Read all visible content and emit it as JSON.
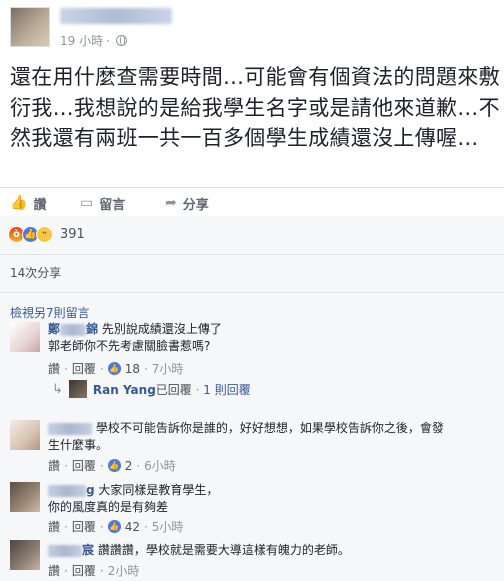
{
  "post": {
    "time": "19 小時",
    "text": "還在用什麼查需要時間…可能會有個資法的問題來敷衍我…我想說的是給我學生名字或是請他來道歉…不然我還有兩班一共一百多個學生成績還沒上傳喔…"
  },
  "actions": {
    "like": "讚",
    "comment": "留言",
    "share": "分享"
  },
  "reactions": {
    "count": "391",
    "icons": [
      "angry-icon",
      "like-icon",
      "haha-icon"
    ]
  },
  "shares": "14次分享",
  "view_more": "檢視另7則留言",
  "comments": [
    {
      "name_visible": "鄭",
      "name_suffix": "錦",
      "lines": [
        "先別說成績還沒上傳了",
        "郭老師你不先考慮關臉書惹嗎?"
      ],
      "like_label": "讚",
      "reply_label": "回覆",
      "likes": "18",
      "time": "7小時",
      "reply": {
        "name": "Ran Yang",
        "text": "已回覆",
        "count": "1 則回覆"
      }
    },
    {
      "name_visible": "",
      "lines": [
        "學校不可能告訴你是誰的，好好想想，如果學校告訴你之後，會發",
        "生什麼事。"
      ],
      "like_label": "讚",
      "reply_label": "回覆",
      "likes": "2",
      "time": "6小時"
    },
    {
      "name_visible": "g",
      "lines": [
        "大家同樣是教育學生，",
        "你的風度真的是有夠差"
      ],
      "like_label": "讚",
      "reply_label": "回覆",
      "likes": "42",
      "time": "5小時"
    },
    {
      "name_visible": "宸",
      "lines": [
        "讚讚讚，學校就是需要大導這樣有魄力的老師。"
      ],
      "like_label": "讚",
      "reply_label": "回覆",
      "time": "2小時"
    }
  ]
}
